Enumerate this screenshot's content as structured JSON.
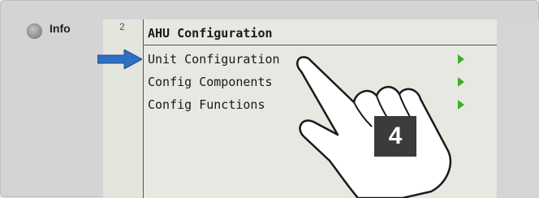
{
  "info_panel": {
    "label": "Info"
  },
  "screen": {
    "line_number": "2",
    "title": "AHU Configuration",
    "items": [
      {
        "label": "Unit Configuration"
      },
      {
        "label": "Config Components"
      },
      {
        "label": "Config Functions"
      }
    ]
  },
  "annotation": {
    "step_number": "4",
    "arrow_color": "#2f6fc4",
    "submenu_arrow_color": "#3fae27",
    "hand_icon": "pointing-hand-icon"
  }
}
